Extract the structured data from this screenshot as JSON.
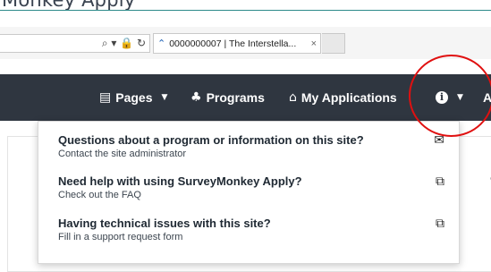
{
  "doc": {
    "title": "Monkey Apply"
  },
  "browser": {
    "address_icons": "⌕ ▾ 🔒 ↻",
    "tab_title": "0000000007 | The Interstella...",
    "tab_close": "×"
  },
  "nav": {
    "pages": "Pages",
    "programs": "Programs",
    "my_applications": "My Applications",
    "info": "i",
    "account_letter": "A"
  },
  "dropdown": {
    "items": [
      {
        "title": "Questions about a program or information on this site?",
        "subtitle": "Contact the site administrator",
        "icon": "envelope-icon"
      },
      {
        "title": "Need help with using SurveyMonkey Apply?",
        "subtitle": "Check out the FAQ",
        "icon": "external-link-icon"
      },
      {
        "title": "Having technical issues with this site?",
        "subtitle": "Fill in a support request form",
        "icon": "external-link-icon"
      }
    ]
  },
  "colors": {
    "navbar": "#2f3640",
    "highlight": "#e01010"
  }
}
